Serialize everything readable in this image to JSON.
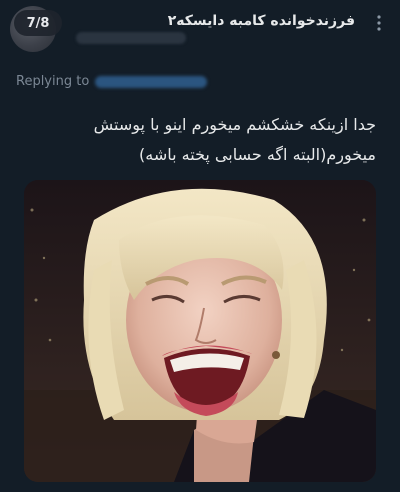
{
  "tweet": {
    "page_counter": "7/8",
    "display_name": "فرزندخوانده کامبه دایسکه۲",
    "replying_to_label": "Replying to",
    "text_line_1": "جدا ازینکه خشکشم میخورم اینو با پوستش",
    "text_line_2": "میخورم(البته اگه حسابی پخته باشه)"
  },
  "icons": {
    "more": "vertical-ellipsis-icon"
  },
  "colors": {
    "background": "#131d27",
    "text": "#e7e9ea",
    "muted": "#7b8794",
    "link": "#2b5580"
  }
}
